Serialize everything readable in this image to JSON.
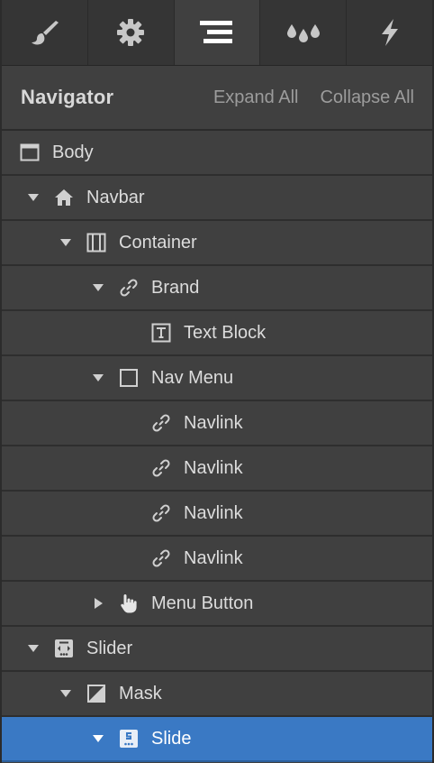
{
  "tabs": [
    {
      "icon": "brush-icon",
      "active": false
    },
    {
      "icon": "gear-icon",
      "active": false
    },
    {
      "icon": "navigator-icon",
      "active": true
    },
    {
      "icon": "drops-icon",
      "active": false
    },
    {
      "icon": "lightning-icon",
      "active": false
    }
  ],
  "header": {
    "title": "Navigator",
    "expand_all": "Expand All",
    "collapse_all": "Collapse All"
  },
  "tree": [
    {
      "label": "Body",
      "icon": "body-icon",
      "depth": 0,
      "caret": "none"
    },
    {
      "label": "Navbar",
      "icon": "home-icon",
      "depth": 1,
      "caret": "down"
    },
    {
      "label": "Container",
      "icon": "container-icon",
      "depth": 2,
      "caret": "down"
    },
    {
      "label": "Brand",
      "icon": "link-icon",
      "depth": 3,
      "caret": "down"
    },
    {
      "label": "Text Block",
      "icon": "text-block-icon",
      "depth": 4,
      "caret": "none"
    },
    {
      "label": "Nav Menu",
      "icon": "box-icon",
      "depth": 3,
      "caret": "down"
    },
    {
      "label": "Navlink",
      "icon": "link-icon",
      "depth": 4,
      "caret": "none"
    },
    {
      "label": "Navlink",
      "icon": "link-icon",
      "depth": 4,
      "caret": "none"
    },
    {
      "label": "Navlink",
      "icon": "link-icon",
      "depth": 4,
      "caret": "none"
    },
    {
      "label": "Navlink",
      "icon": "link-icon",
      "depth": 4,
      "caret": "none"
    },
    {
      "label": "Menu Button",
      "icon": "hand-icon",
      "depth": 3,
      "caret": "right"
    },
    {
      "label": "Slider",
      "icon": "slider-icon",
      "depth": 1,
      "caret": "down"
    },
    {
      "label": "Mask",
      "icon": "mask-icon",
      "depth": 2,
      "caret": "down"
    },
    {
      "label": "Slide",
      "icon": "slide-icon",
      "depth": 3,
      "caret": "down",
      "selected": true
    }
  ],
  "colors": {
    "panel_bg": "#404040",
    "tabbar_bg": "#353535",
    "selected_bg": "#3a79c4",
    "text": "#dcdcdc",
    "muted_text": "#9c9c9c"
  }
}
